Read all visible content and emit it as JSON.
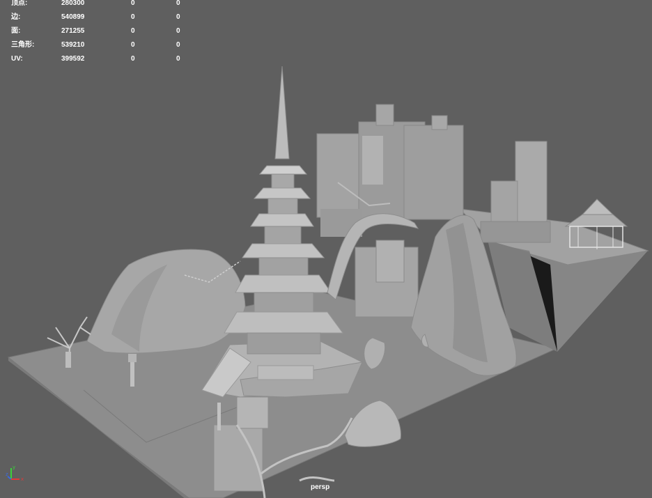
{
  "hud": {
    "rows": [
      {
        "label": "顶点:",
        "v1": "280300",
        "v2": "0",
        "v3": "0"
      },
      {
        "label": "边:",
        "v1": "540899",
        "v2": "0",
        "v3": "0"
      },
      {
        "label": "面:",
        "v1": "271255",
        "v2": "0",
        "v3": "0"
      },
      {
        "label": "三角形:",
        "v1": "539210",
        "v2": "0",
        "v3": "0"
      },
      {
        "label": "UV:",
        "v1": "399592",
        "v2": "0",
        "v3": "0"
      }
    ]
  },
  "camera": {
    "name": "persp"
  },
  "axis": {
    "x_label": "x",
    "y_label": "y",
    "z_label": "z"
  },
  "colors": {
    "background": "#5f5f5f",
    "text": "#ffffff",
    "axis_x": "#e23a3a",
    "axis_y": "#3ad23a",
    "axis_z": "#3a6ae2"
  }
}
